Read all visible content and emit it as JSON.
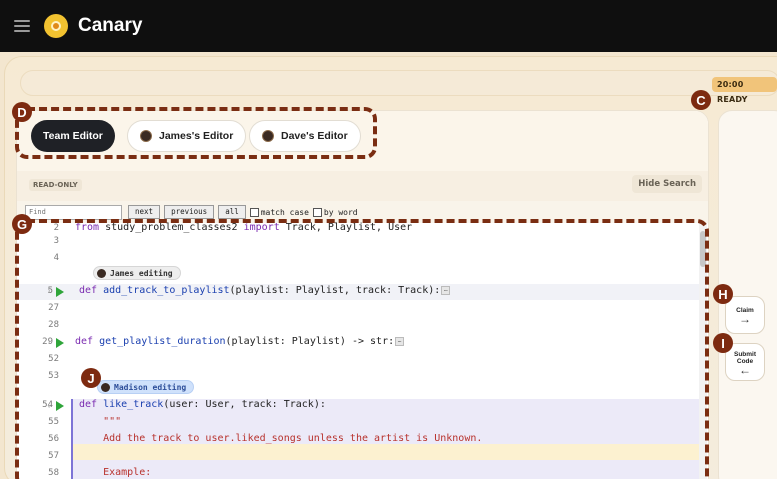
{
  "app": {
    "title": "Canary",
    "menu_icon": "hamburger-menu-icon",
    "logo_icon": "canary-logo-icon"
  },
  "timer": {
    "label": "20:00 READY"
  },
  "tabs": [
    {
      "label": "Team Editor",
      "active": true
    },
    {
      "label": "James's Editor",
      "active": false,
      "avatar": "avatar-icon"
    },
    {
      "label": "Dave's Editor",
      "active": false,
      "avatar": "avatar-icon"
    }
  ],
  "toolbar": {
    "readonly_label": "READ-ONLY",
    "hide_search_label": "Hide Search"
  },
  "search": {
    "placeholder": "Find",
    "next_label": "next",
    "previous_label": "previous",
    "all_label": "all",
    "match_case_label": "match case",
    "by_word_label": "by word"
  },
  "code": {
    "lines": [
      {
        "num": "2",
        "text_kw1": "from",
        "text_rest": " study_problem_classes2 ",
        "text_kw2": "import",
        "text_tail": " Track, Playlist, User"
      },
      {
        "num": "3"
      },
      {
        "num": "4"
      },
      {
        "num": "5",
        "fold": "›",
        "kw": "def",
        "fn": "add_track_to_playlist",
        "rest": "(playlist: Playlist, track: Track):"
      },
      {
        "num": "27"
      },
      {
        "num": "28"
      },
      {
        "num": "29",
        "fold": "›",
        "kw": "def",
        "fn": "get_playlist_duration",
        "rest": "(playlist: Playlist) -> str:"
      },
      {
        "num": "52"
      },
      {
        "num": "53"
      },
      {
        "num": "54",
        "fold": "⌄",
        "kw": "def",
        "fn": "like_track",
        "rest": "(user: User, track: Track):"
      },
      {
        "num": "55",
        "str": "    \"\"\""
      },
      {
        "num": "56",
        "str": "    Add the track to user.liked_songs unless the artist is Unknown."
      },
      {
        "num": "57"
      },
      {
        "num": "58",
        "str": "    Example:"
      }
    ],
    "james_chip": "James editing",
    "madison_chip": "Madison editing"
  },
  "side": {
    "claim_label": "Claim",
    "claim_arrow": "→",
    "submit_label_1": "Submit",
    "submit_label_2": "Code",
    "submit_arrow": "←"
  },
  "annotations": {
    "C": "C",
    "D": "D",
    "G": "G",
    "H": "H",
    "I": "I",
    "J": "J"
  },
  "colors": {
    "accent": "#7d2a10",
    "madison": "#7d74d6",
    "run": "#2fa53a"
  }
}
